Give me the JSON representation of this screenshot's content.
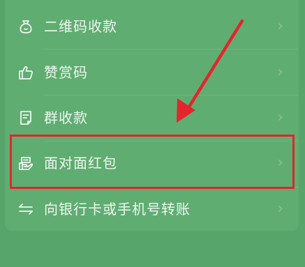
{
  "menu": {
    "items": [
      {
        "label": "二维码收款",
        "icon": "money-bag-icon"
      },
      {
        "label": "赞赏码",
        "icon": "thumbs-up-icon"
      },
      {
        "label": "群收款",
        "icon": "document-icon"
      },
      {
        "label": "面对面红包",
        "icon": "red-packet-icon"
      },
      {
        "label": "向银行卡或手机号转账",
        "icon": "transfer-icon"
      }
    ],
    "chevron": "›"
  },
  "annotation": {
    "highlight_color": "#e4252b",
    "arrow_color": "#e4252b"
  },
  "colors": {
    "background": "#57a56b",
    "card": "#60ad72",
    "text": "#eef6f0"
  }
}
